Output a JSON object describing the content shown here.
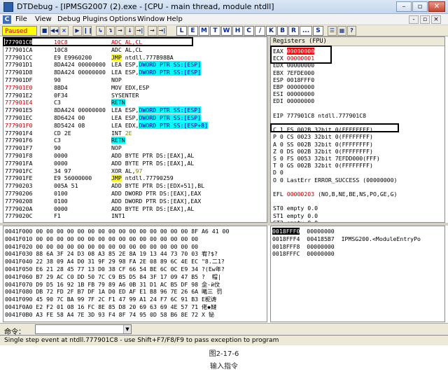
{
  "window": {
    "title": "DTDebug - [IPMSG2007 (2).exe - [CPU - main thread, module ntdll]",
    "min": "–",
    "restore": "▫",
    "close": "✕"
  },
  "menu": {
    "items": [
      "File",
      "View",
      "Debug",
      "Plugins",
      "Options",
      "Window",
      "Help"
    ],
    "mdi": [
      "-",
      "▫",
      "×"
    ]
  },
  "toolbar": {
    "status": "Paused",
    "icons": [
      "■",
      "◀◀",
      "×",
      "▶",
      "❙❙",
      "↳",
      "↴",
      "→",
      "↓",
      "→|"
    ],
    "letters": [
      "L",
      "E",
      "M",
      "T",
      "W",
      "H",
      "C",
      "/",
      "K",
      "B",
      "R",
      "...",
      "S"
    ],
    "extra": [
      "☰",
      "▦",
      "?"
    ]
  },
  "cpu": {
    "rows": [
      {
        "addr": "777901C8",
        "hex": "10C8",
        "asm": "ADC AL,CL",
        "addr_red": false,
        "selected": true
      },
      {
        "addr": "777901CA",
        "hex": "10C8",
        "asm": "ADC AL,CL",
        "addr_red": false,
        "selected": false
      },
      {
        "addr": "777901CC",
        "hex": "E9 E9960200",
        "asm_kw": "JMP",
        "asm": " ntdll.777B98BA",
        "addr_red": false,
        "jmp": true
      },
      {
        "addr": "777901D1",
        "hex": "8DA424 00000000",
        "asm": "LEA ESP,",
        "asm_hl": "DWORD PTR SS:[ESP]",
        "addr_red": false
      },
      {
        "addr": "777901D8",
        "hex": "8DA424 00000000",
        "asm": "LEA ESP,",
        "asm_hl": "DWORD PTR SS:[ESP]",
        "addr_red": false
      },
      {
        "addr": "777901DF",
        "hex": "90",
        "asm": "NOP",
        "addr_red": false
      },
      {
        "addr": "777901E0",
        "hex": "8BD4",
        "asm": "MOV EDX,ESP",
        "addr_red": true
      },
      {
        "addr": "777901E2",
        "hex": "0F34",
        "asm": "SYSENTER",
        "addr_red": false
      },
      {
        "addr": "777901E4",
        "hex": "C3",
        "asm_ret": "RETN",
        "asm": "",
        "addr_red": true
      },
      {
        "addr": "777901E5",
        "hex": "8DA424 00000000",
        "asm": "LEA ESP,",
        "asm_hl": "DWORD PTR SS:[ESP]",
        "addr_red": false
      },
      {
        "addr": "777901EC",
        "hex": "8D6424 00",
        "asm": "LEA ESP,",
        "asm_hl": "DWORD PTR SS:[ESP]",
        "addr_red": false
      },
      {
        "addr": "777901F0",
        "hex": "8D5424 08",
        "asm": "LEA EDX,",
        "asm_hl": "DWORD PTR SS:[ESP+8]",
        "addr_red": true
      },
      {
        "addr": "777901F4",
        "hex": "CD 2E",
        "asm": "INT ",
        "asm_imm": "2E",
        "addr_red": false
      },
      {
        "addr": "777901F6",
        "hex": "C3",
        "asm_ret": "RETN",
        "asm": "",
        "addr_red": false
      },
      {
        "addr": "777901F7",
        "hex": "90",
        "asm": "NOP",
        "addr_red": false
      },
      {
        "addr": "777901F8",
        "hex": "0000",
        "asm": "ADD BYTE PTR DS:[EAX],AL",
        "addr_red": false
      },
      {
        "addr": "777901FA",
        "hex": "0000",
        "asm": "ADD BYTE PTR DS:[EAX],AL",
        "addr_red": false
      },
      {
        "addr": "777901FC",
        "hex": "34 97",
        "asm": "XOR AL,",
        "asm_imm": "97",
        "addr_red": false
      },
      {
        "addr": "777901FE",
        "hex": "E9 56000000",
        "asm_kw": "JMP",
        "asm": " ntdll.77790259",
        "addr_red": false,
        "jmp": true
      },
      {
        "addr": "77790203",
        "hex": "005A 51",
        "asm": "ADD BYTE PTR DS:[EDX+51],BL",
        "addr_red": false
      },
      {
        "addr": "77790206",
        "hex": "0100",
        "asm": "ADD DWORD PTR DS:[EAX],EAX",
        "addr_red": false
      },
      {
        "addr": "77790208",
        "hex": "0100",
        "asm": "ADD DWORD PTR DS:[EAX],EAX",
        "addr_red": false
      },
      {
        "addr": "7779020A",
        "hex": "0000",
        "asm": "ADD BYTE PTR DS:[EAX],AL",
        "addr_red": false
      },
      {
        "addr": "7779020C",
        "hex": "F1",
        "asm": "INT1",
        "addr_red": false
      }
    ]
  },
  "registers": {
    "header": "Registers (FPU)",
    "lines": [
      {
        "name": "EAX",
        "value": "00000000",
        "extra": "",
        "hl": true
      },
      {
        "name": "ECX",
        "value": "00000001",
        "extra": "",
        "red": true
      },
      {
        "name": "EDX",
        "value": "00000000",
        "extra": ""
      },
      {
        "name": "EBX",
        "value": "7EFDE000",
        "extra": ""
      },
      {
        "name": "ESP",
        "value": "0018FFF0",
        "extra": ""
      },
      {
        "name": "EBP",
        "value": "00000000",
        "extra": ""
      },
      {
        "name": "ESI",
        "value": "00000000",
        "extra": ""
      },
      {
        "name": "EDI",
        "value": "00000000",
        "extra": ""
      },
      {
        "name": "",
        "value": "",
        "extra": ""
      },
      {
        "name": "EIP",
        "value": "777901C8",
        "extra": "ntdll.777901C8"
      },
      {
        "name": "",
        "value": "",
        "extra": ""
      },
      {
        "name": "C 1",
        "value": "ES 002B",
        "extra": "32bit 0(FFFFFFFF)"
      },
      {
        "name": "P 0",
        "value": "CS 0023",
        "extra": "32bit 0(FFFFFFFF)"
      },
      {
        "name": "A 0",
        "value": "SS 002B",
        "extra": "32bit 0(FFFFFFFF)"
      },
      {
        "name": "Z 0",
        "value": "DS 002B",
        "extra": "32bit 0(FFFFFFFF)"
      },
      {
        "name": "S 0",
        "value": "FS 0053",
        "extra": "32bit 7EFDD000(FFF)"
      },
      {
        "name": "T 0",
        "value": "GS 002B",
        "extra": "32bit 0(FFFFFFFF)"
      },
      {
        "name": "D 0",
        "value": "",
        "extra": ""
      },
      {
        "name": "O 0",
        "value": "LastErr",
        "extra": "ERROR_SUCCESS (00000000)"
      },
      {
        "name": "",
        "value": "",
        "extra": ""
      },
      {
        "name": "EFL",
        "value": "00000203",
        "extra": "(NO,B,NE,BE,NS,PO,GE,G)",
        "red": true
      },
      {
        "name": "",
        "value": "",
        "extra": ""
      },
      {
        "name": "ST0",
        "value": "empty",
        "extra": "0.0"
      },
      {
        "name": "ST1",
        "value": "empty",
        "extra": "0.0"
      },
      {
        "name": "ST2",
        "value": "empty",
        "extra": "0.0"
      }
    ]
  },
  "dump": {
    "rows": [
      {
        "addr": "0041F000",
        "hex": "00 00 00 00 00 00 00 00 00 00 00 00 00 00 00 8F",
        "ascii": "A6 41 00"
      },
      {
        "addr": "0041F010",
        "hex": "00 00 00 00 00 00 00 00 00 00 00 00 00 00 00 00",
        "ascii": ""
      },
      {
        "addr": "0041F020",
        "hex": "00 00 00 00 00 00 00 00 00 00 00 00 00 00 00 00",
        "ascii": ""
      },
      {
        "addr": "0041F030",
        "hex": "88 6A 3F 24 D3 08 A3 85 2E 8A 19 13 44 73 70 03",
        "ascii": "宥?$?"
      },
      {
        "addr": "0041F040",
        "hex": "22 38 09 A4 D0 31 9F 29 98 FA 2E 08 89 6C 4E EC",
        "ascii": "\"8.二1?"
      },
      {
        "addr": "0041F050",
        "hex": "E6 21 28 45 77 13 D0 38 CF 66 54 BE 6C 0C E9 34",
        "ascii": "?(Ew年?"
      },
      {
        "addr": "0041F060",
        "hex": "B7 29 AC C0 DD 50 7C C9 B5 D5 84 3F 17 09 47 B5",
        "ascii": "?  帽|"
      },
      {
        "addr": "0041F070",
        "hex": "D9 D5 16 92 1B FB 79 89 A6 0B 31 D1 AC B5 DF 98",
        "ascii": "佱‐й伩"
      },
      {
        "addr": "0041F080",
        "hex": "DB 72 FD 2F B7 DF 1A D0 ED AF E1 B8 96 7E 26 6A",
        "ascii": "曦三 罚"
      },
      {
        "addr": "0041F090",
        "hex": "45 90 7C BA 99 7F 2C F1 47 99 A1 24 F7 6C 91 B3",
        "ascii": "E柅诪"
      },
      {
        "addr": "0041F0A0",
        "hex": "E2 F2 01 08 16 FC 8E 85 D8 20 69 63 69 4E 57 71",
        "ascii": "佬◆䲇"
      },
      {
        "addr": "0041F0B0",
        "hex": "A3 FE 58 A4 7E 3D 93 F4 8F 74 95 0D 58 B6 8E 72",
        "ascii": "X 铋"
      }
    ]
  },
  "stack": {
    "rows": [
      {
        "addr": "0018FFF0",
        "value": "00000000",
        "comment": "",
        "selected": true
      },
      {
        "addr": "0018FFF4",
        "value": "004185B7",
        "comment": "IPMSG200.<ModuleEntryPo"
      },
      {
        "addr": "0018FFF8",
        "value": "00000000",
        "comment": ""
      },
      {
        "addr": "0018FFFC",
        "value": "00000000",
        "comment": ""
      }
    ]
  },
  "command": {
    "label": "命令：",
    "value": "",
    "drop": "▼"
  },
  "status": {
    "text": "Single step event at ntdll.777901C8 - use Shift+F7/F8/F9 to pass exception to program"
  },
  "caption": {
    "figure": "图2-17-6",
    "text": "输入指令"
  }
}
